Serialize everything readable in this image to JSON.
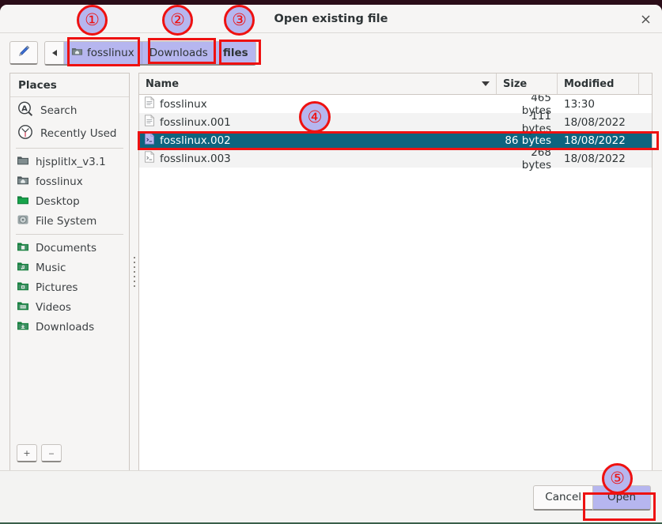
{
  "window": {
    "title": "Open existing file",
    "close_icon": "close-icon"
  },
  "pathbar": {
    "edit_icon": "pencil-icon",
    "prev_icon": "chevron-left-icon",
    "crumbs": [
      {
        "label": "fosslinux",
        "icon": "home-folder-icon",
        "current": false
      },
      {
        "label": "Downloads",
        "icon": "",
        "current": false
      },
      {
        "label": "files",
        "icon": "",
        "current": true
      }
    ]
  },
  "sidebar": {
    "header": "Places",
    "items": [
      {
        "label": "Search",
        "icon": "search-icon",
        "group": 0
      },
      {
        "label": "Recently Used",
        "icon": "clock-icon",
        "group": 0
      },
      {
        "label": "hjsplitlx_v3.1",
        "icon": "folder-icon",
        "group": 1
      },
      {
        "label": "fosslinux",
        "icon": "home-folder-icon",
        "group": 1
      },
      {
        "label": "Desktop",
        "icon": "desktop-folder-icon",
        "group": 1
      },
      {
        "label": "File System",
        "icon": "disk-icon",
        "group": 1
      },
      {
        "label": "Documents",
        "icon": "documents-folder-icon",
        "group": 2
      },
      {
        "label": "Music",
        "icon": "music-folder-icon",
        "group": 2
      },
      {
        "label": "Pictures",
        "icon": "pictures-folder-icon",
        "group": 2
      },
      {
        "label": "Videos",
        "icon": "videos-folder-icon",
        "group": 2
      },
      {
        "label": "Downloads",
        "icon": "downloads-folder-icon",
        "group": 2
      }
    ],
    "add_label": "+",
    "remove_label": "‒"
  },
  "filelist": {
    "columns": {
      "name": "Name",
      "size": "Size",
      "modified": "Modified"
    },
    "sort_icon": "sort-descending-icon",
    "rows": [
      {
        "name": "fosslinux",
        "size": "465 bytes",
        "modified": "13:30",
        "icon": "text-file-icon",
        "selected": false
      },
      {
        "name": "fosslinux.001",
        "size": "111 bytes",
        "modified": "18/08/2022",
        "icon": "text-file-icon",
        "selected": false
      },
      {
        "name": "fosslinux.002",
        "size": "86 bytes",
        "modified": "18/08/2022",
        "icon": "script-file-icon",
        "selected": true
      },
      {
        "name": "fosslinux.003",
        "size": "268 bytes",
        "modified": "18/08/2022",
        "icon": "script-file-icon",
        "selected": false
      }
    ]
  },
  "footer": {
    "cancel_label": "Cancel",
    "open_label": "Open"
  },
  "annotations": {
    "markers": [
      {
        "number": "①"
      },
      {
        "number": "②"
      },
      {
        "number": "③"
      },
      {
        "number": "④"
      },
      {
        "number": "⑤"
      }
    ],
    "color": "#ee1111",
    "fill": "#b6b6ef"
  }
}
